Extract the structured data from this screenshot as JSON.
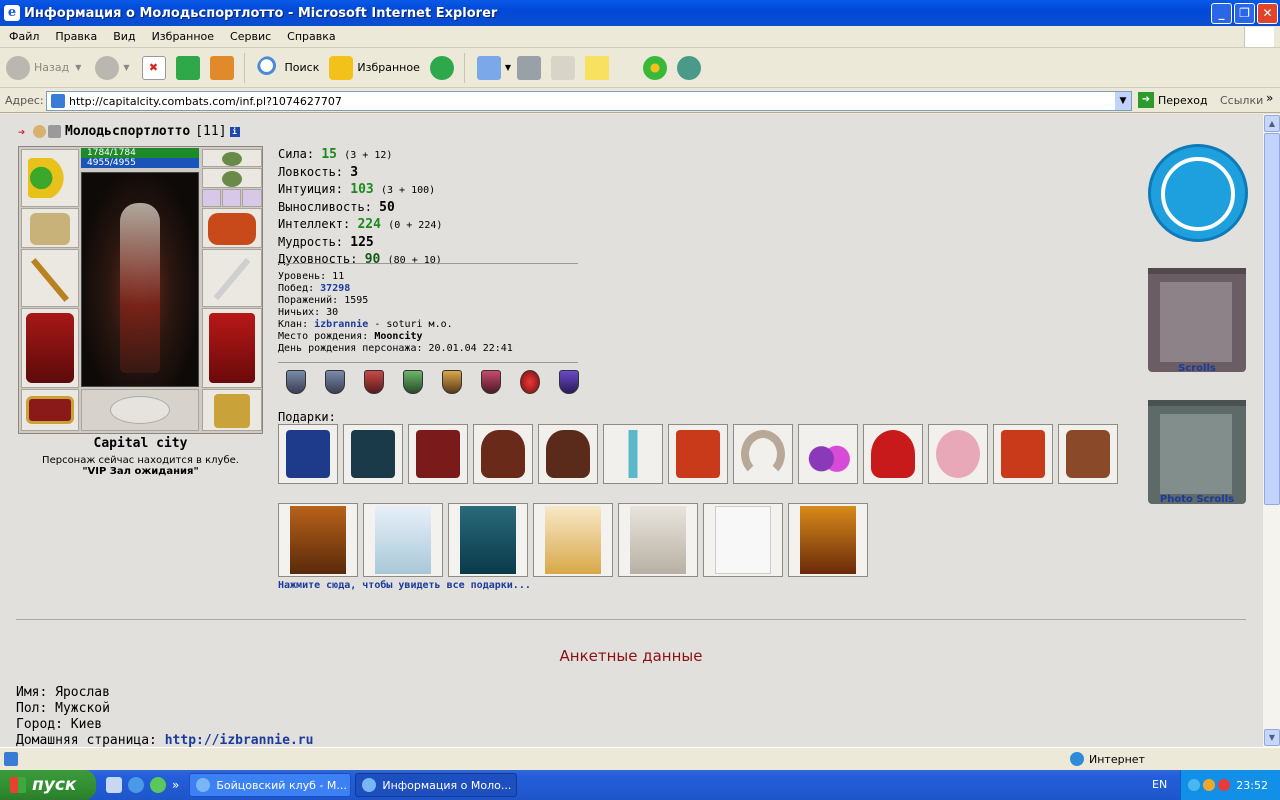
{
  "window": {
    "title": "Информация о Молодьспортлотто - Microsoft Internet Explorer",
    "min": "_",
    "max": "❐",
    "close": "✕"
  },
  "menu": [
    "Файл",
    "Правка",
    "Вид",
    "Избранное",
    "Сервис",
    "Справка"
  ],
  "toolbar": {
    "back": "Назад",
    "search": "Поиск",
    "favorites": "Избранное"
  },
  "address": {
    "label": "Адрес:",
    "url": "http://capitalcity.combats.com/inf.pl?1074627707",
    "go": "Переход",
    "links": "Ссылки"
  },
  "character": {
    "name": "Молодьспортлотто",
    "level": "[11]",
    "hp": "1784/1784",
    "mana": "4955/4955",
    "city": "Capital city",
    "location_text": "Персонаж сейчас находится в клубе.",
    "location_room": "\"VIP Зал ожидания\""
  },
  "stats": [
    {
      "label": "Сила:",
      "value": "15",
      "extra": "(3 + 12)",
      "color": "green"
    },
    {
      "label": "Ловкость:",
      "value": "3",
      "extra": "",
      "color": "dark"
    },
    {
      "label": "Интуиция:",
      "value": "103",
      "extra": "(3 + 100)",
      "color": "green"
    },
    {
      "label": "Выносливость:",
      "value": "50",
      "extra": "",
      "color": "dark"
    },
    {
      "label": "Интеллект:",
      "value": "224",
      "extra": "(0 + 224)",
      "color": "green"
    },
    {
      "label": "Мудрость:",
      "value": "125",
      "extra": "",
      "color": "dark"
    },
    {
      "label": "Духовность:",
      "value": "90",
      "extra": "(80 + 10)",
      "color": "green"
    }
  ],
  "info": {
    "level": "Уровень: 11",
    "wins_label": "Побед:",
    "wins": "37298",
    "losses": "Поражений: 1595",
    "draws": "Ничьих: 30",
    "clan_label": "Клан:",
    "clan": "izbrannie",
    "clan_rest": "- soturi м.о.",
    "birthplace_label": "Место рождения:",
    "birthplace": "Mooncity",
    "birthday": "День рождения персонажа: 20.01.04 22:41"
  },
  "gifts_label": "Подарки:",
  "see_all": "Нажмите сюда, чтобы увидеть все подарки...",
  "side": {
    "scrolls": "Scrolls",
    "photo_scrolls": "Photo Scrolls"
  },
  "anketa": {
    "title": "Анкетные данные",
    "name": "Имя: Ярослав",
    "sex": "Пол: Мужской",
    "city": "Город: Киев",
    "homepage_label": "Домашняя страница:",
    "homepage": "http://izbrannie.ru"
  },
  "status": {
    "zone": "Интернет"
  },
  "taskbar": {
    "start": "пуск",
    "task1": "Бойцовский клуб - M...",
    "task2": "Информация о Моло...",
    "lang": "EN",
    "clock": "23:52"
  },
  "colors": {
    "green": "#1b8a1b",
    "link": "#1a3b9c",
    "anket_title": "#8a1111"
  }
}
